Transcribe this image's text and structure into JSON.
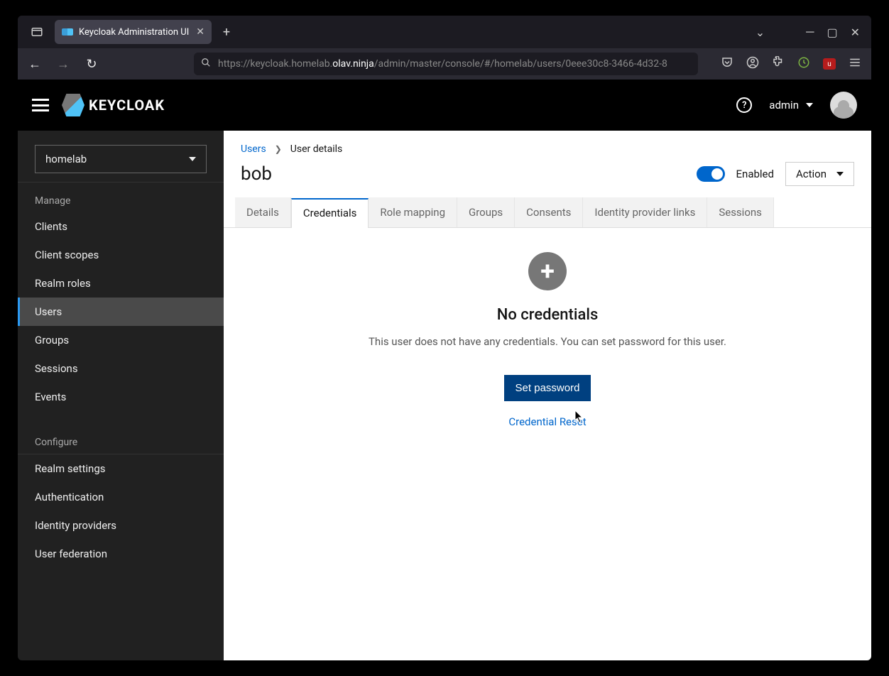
{
  "browser": {
    "tab_title": "Keycloak Administration UI",
    "url_prefix": "https://keycloak.homelab.",
    "url_highlight": "olav.ninja",
    "url_suffix": "/admin/master/console/#/homelab/users/0eee30c8-3466-4d32-8"
  },
  "header": {
    "brand": "KEYCLOAK",
    "username": "admin"
  },
  "sidebar": {
    "realm": "homelab",
    "sections": {
      "manage_label": "Manage",
      "configure_label": "Configure"
    },
    "manage_items": [
      "Clients",
      "Client scopes",
      "Realm roles",
      "Users",
      "Groups",
      "Sessions",
      "Events"
    ],
    "configure_items": [
      "Realm settings",
      "Authentication",
      "Identity providers",
      "User federation"
    ]
  },
  "breadcrumb": {
    "users": "Users",
    "detail": "User details"
  },
  "page": {
    "title": "bob",
    "enabled_label": "Enabled",
    "action_label": "Action"
  },
  "tabs": [
    "Details",
    "Credentials",
    "Role mapping",
    "Groups",
    "Consents",
    "Identity provider links",
    "Sessions"
  ],
  "active_tab": "Credentials",
  "empty": {
    "title": "No credentials",
    "desc": "This user does not have any credentials. You can set password for this user.",
    "set_password": "Set password",
    "credential_reset": "Credential Reset"
  }
}
